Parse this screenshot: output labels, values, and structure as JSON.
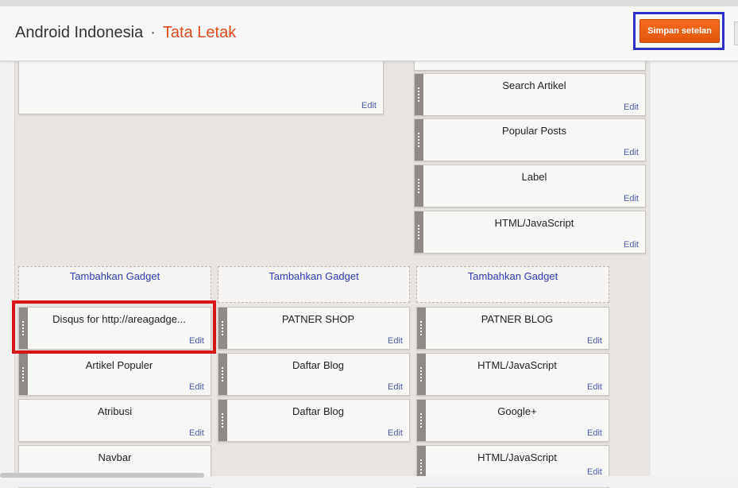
{
  "header": {
    "blog_name": "Android Indonesia",
    "separator": "·",
    "page_name": "Tata Letak",
    "save_label": "Simpan setelan"
  },
  "top_gadget": {
    "edit": "Edit"
  },
  "sidebar_gadgets": [
    {
      "name": "Search Artikel",
      "edit": "Edit"
    },
    {
      "name": "Popular Posts",
      "edit": "Edit"
    },
    {
      "name": "Label",
      "edit": "Edit"
    },
    {
      "name": "HTML/JavaScript",
      "edit": "Edit"
    }
  ],
  "add_gadget_label": "Tambahkan Gadget",
  "footer_columns": [
    {
      "gadgets": [
        {
          "name": "Disqus for http://areagadge...",
          "edit": "Edit"
        },
        {
          "name": "Artikel Populer",
          "edit": "Edit"
        },
        {
          "name": "Atribusi",
          "edit": "Edit"
        },
        {
          "name": "Navbar",
          "edit": ""
        }
      ]
    },
    {
      "gadgets": [
        {
          "name": "PATNER SHOP",
          "edit": "Edit"
        },
        {
          "name": "Daftar Blog",
          "edit": "Edit"
        },
        {
          "name": "Daftar Blog",
          "edit": "Edit"
        }
      ]
    },
    {
      "gadgets": [
        {
          "name": "PATNER BLOG",
          "edit": "Edit"
        },
        {
          "name": "HTML/JavaScript",
          "edit": "Edit"
        },
        {
          "name": "Google+",
          "edit": "Edit"
        },
        {
          "name": "HTML/JavaScript",
          "edit": "Edit"
        }
      ]
    }
  ]
}
